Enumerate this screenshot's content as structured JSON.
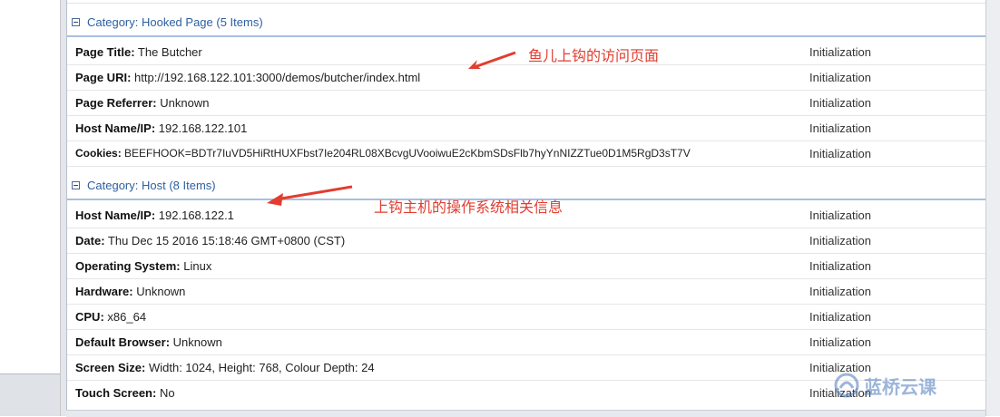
{
  "categories": [
    {
      "title": "Category: Hooked Page (5 Items)",
      "rows": [
        {
          "key": "Page Title",
          "value": "The Butcher",
          "source": "Initialization"
        },
        {
          "key": "Page URI",
          "value": "http://192.168.122.101:3000/demos/butcher/index.html",
          "source": "Initialization"
        },
        {
          "key": "Page Referrer",
          "value": "Unknown",
          "source": "Initialization"
        },
        {
          "key": "Host Name/IP",
          "value": "192.168.122.101",
          "source": "Initialization"
        },
        {
          "key": "Cookies",
          "value": "BEEFHOOK=BDTr7IuVD5HiRtHUXFbst7Ie204RL08XBcvgUVooiwuE2cKbmSDsFlb7hyYnNIZZTue0D1M5RgD3sT7V",
          "source": "Initialization"
        }
      ]
    },
    {
      "title": "Category: Host (8 Items)",
      "rows": [
        {
          "key": "Host Name/IP",
          "value": "192.168.122.1",
          "source": "Initialization"
        },
        {
          "key": "Date",
          "value": "Thu Dec 15 2016 15:18:46 GMT+0800 (CST)",
          "source": "Initialization"
        },
        {
          "key": "Operating System",
          "value": "Linux",
          "source": "Initialization"
        },
        {
          "key": "Hardware",
          "value": "Unknown",
          "source": "Initialization"
        },
        {
          "key": "CPU",
          "value": "x86_64",
          "source": "Initialization"
        },
        {
          "key": "Default Browser",
          "value": "Unknown",
          "source": "Initialization"
        },
        {
          "key": "Screen Size",
          "value": "Width: 1024, Height: 768, Colour Depth: 24",
          "source": "Initialization"
        },
        {
          "key": "Touch Screen",
          "value": "No",
          "source": "Initialization"
        }
      ]
    }
  ],
  "annotations": {
    "hooked_page_note": "鱼儿上钩的访问页面",
    "host_note": "上钩主机的操作系统相关信息",
    "color": "#e23d2f"
  },
  "watermark": {
    "text": "蓝桥云课",
    "icon": "lanqiao-logo-icon"
  },
  "colors": {
    "category_title": "#2d5fa0",
    "category_border": "#a9bfdd"
  }
}
